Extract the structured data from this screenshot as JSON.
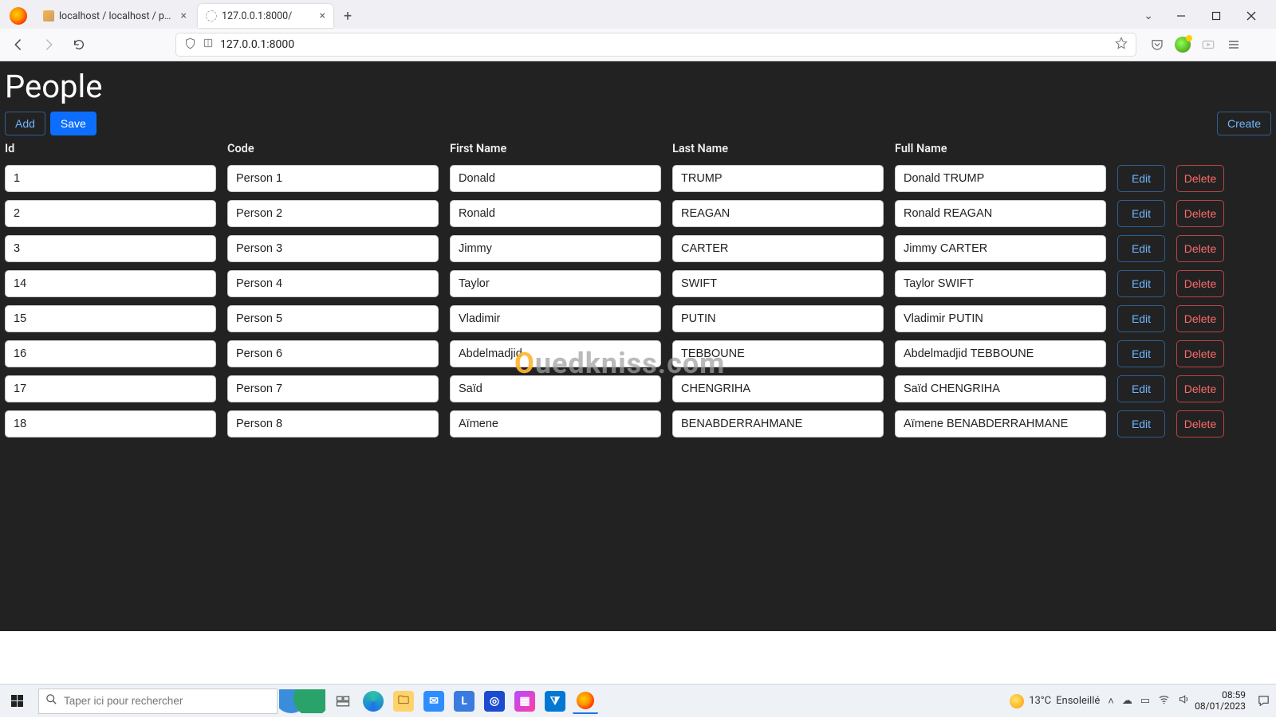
{
  "browser": {
    "tabs": [
      {
        "title": "localhost / localhost / people /",
        "active": false,
        "favicon": "phpmyadmin"
      },
      {
        "title": "127.0.0.1:8000/",
        "active": true,
        "favicon": "blank"
      }
    ],
    "address": "127.0.0.1:8000"
  },
  "page": {
    "title": "People",
    "buttons": {
      "add": "Add",
      "save": "Save",
      "create": "Create"
    },
    "columns": {
      "id": "Id",
      "code": "Code",
      "first_name": "First Name",
      "last_name": "Last Name",
      "full_name": "Full Name"
    },
    "row_actions": {
      "edit": "Edit",
      "delete": "Delete"
    },
    "rows": [
      {
        "id": "1",
        "code": "Person 1",
        "first_name": "Donald",
        "last_name": "TRUMP",
        "full_name": "Donald TRUMP"
      },
      {
        "id": "2",
        "code": "Person 2",
        "first_name": "Ronald",
        "last_name": "REAGAN",
        "full_name": "Ronald REAGAN"
      },
      {
        "id": "3",
        "code": "Person 3",
        "first_name": "Jimmy",
        "last_name": "CARTER",
        "full_name": "Jimmy CARTER"
      },
      {
        "id": "14",
        "code": "Person 4",
        "first_name": "Taylor",
        "last_name": "SWIFT",
        "full_name": "Taylor SWIFT"
      },
      {
        "id": "15",
        "code": "Person 5",
        "first_name": "Vladimir",
        "last_name": "PUTIN",
        "full_name": "Vladimir PUTIN"
      },
      {
        "id": "16",
        "code": "Person 6",
        "first_name": "Abdelmadjid",
        "last_name": "TEBBOUNE",
        "full_name": "Abdelmadjid TEBBOUNE"
      },
      {
        "id": "17",
        "code": "Person 7",
        "first_name": "Saïd",
        "last_name": "CHENGRIHA",
        "full_name": "Saïd CHENGRIHA"
      },
      {
        "id": "18",
        "code": "Person 8",
        "first_name": "Aïmene",
        "last_name": "BENABDERRAHMANE",
        "full_name": "Aïmene BENABDERRAHMANE"
      }
    ]
  },
  "watermark": {
    "first": "O",
    "rest": "uedkniss.com"
  },
  "taskbar": {
    "search_placeholder": "Taper ici pour rechercher",
    "weather_temp": "13°C",
    "weather_label": "Ensoleillé",
    "time": "08:59",
    "date": "08/01/2023"
  }
}
